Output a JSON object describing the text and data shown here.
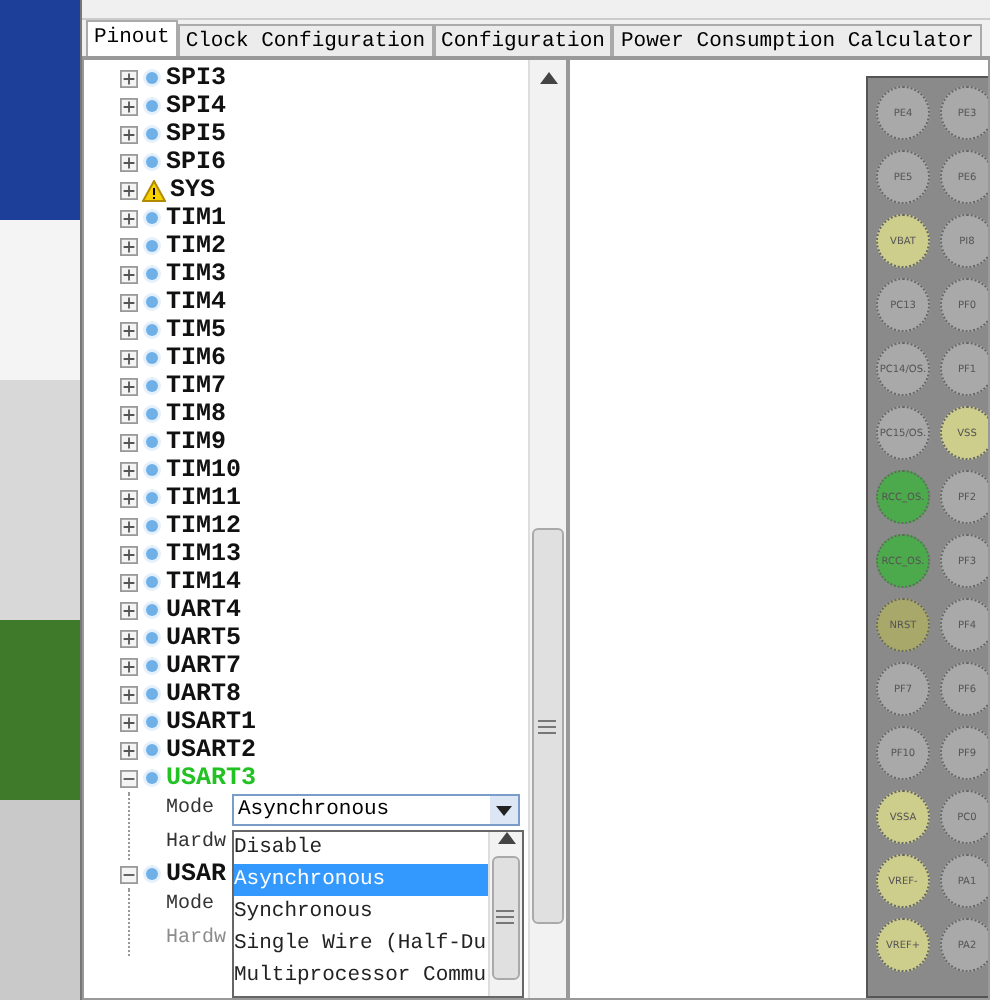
{
  "tabs": [
    {
      "label": "Pinout",
      "selected": true
    },
    {
      "label": "Clock Configuration",
      "selected": false
    },
    {
      "label": "Configuration",
      "selected": false
    },
    {
      "label": "Power Consumption Calculator",
      "selected": false
    }
  ],
  "tree": {
    "items": [
      {
        "label": "SPI3",
        "kind": "ok",
        "expanded": false,
        "configured": false
      },
      {
        "label": "SPI4",
        "kind": "ok",
        "expanded": false,
        "configured": false
      },
      {
        "label": "SPI5",
        "kind": "ok",
        "expanded": false,
        "configured": false
      },
      {
        "label": "SPI6",
        "kind": "ok",
        "expanded": false,
        "configured": false
      },
      {
        "label": "SYS",
        "kind": "warning",
        "expanded": false,
        "configured": false
      },
      {
        "label": "TIM1",
        "kind": "ok",
        "expanded": false,
        "configured": false
      },
      {
        "label": "TIM2",
        "kind": "ok",
        "expanded": false,
        "configured": false
      },
      {
        "label": "TIM3",
        "kind": "ok",
        "expanded": false,
        "configured": false
      },
      {
        "label": "TIM4",
        "kind": "ok",
        "expanded": false,
        "configured": false
      },
      {
        "label": "TIM5",
        "kind": "ok",
        "expanded": false,
        "configured": false
      },
      {
        "label": "TIM6",
        "kind": "ok",
        "expanded": false,
        "configured": false
      },
      {
        "label": "TIM7",
        "kind": "ok",
        "expanded": false,
        "configured": false
      },
      {
        "label": "TIM8",
        "kind": "ok",
        "expanded": false,
        "configured": false
      },
      {
        "label": "TIM9",
        "kind": "ok",
        "expanded": false,
        "configured": false
      },
      {
        "label": "TIM10",
        "kind": "ok",
        "expanded": false,
        "configured": false
      },
      {
        "label": "TIM11",
        "kind": "ok",
        "expanded": false,
        "configured": false
      },
      {
        "label": "TIM12",
        "kind": "ok",
        "expanded": false,
        "configured": false
      },
      {
        "label": "TIM13",
        "kind": "ok",
        "expanded": false,
        "configured": false
      },
      {
        "label": "TIM14",
        "kind": "ok",
        "expanded": false,
        "configured": false
      },
      {
        "label": "UART4",
        "kind": "ok",
        "expanded": false,
        "configured": false
      },
      {
        "label": "UART5",
        "kind": "ok",
        "expanded": false,
        "configured": false
      },
      {
        "label": "UART7",
        "kind": "ok",
        "expanded": false,
        "configured": false
      },
      {
        "label": "UART8",
        "kind": "ok",
        "expanded": false,
        "configured": false
      },
      {
        "label": "USART1",
        "kind": "ok",
        "expanded": false,
        "configured": false
      },
      {
        "label": "USART2",
        "kind": "ok",
        "expanded": false,
        "configured": false
      },
      {
        "label": "USART3",
        "kind": "ok",
        "expanded": true,
        "configured": true,
        "children": [
          {
            "kind": "combo",
            "label": "Mode",
            "value": "Asynchronous",
            "open": true,
            "options": [
              {
                "label": "Disable",
                "selected": false
              },
              {
                "label": "Asynchronous",
                "selected": true
              },
              {
                "label": "Synchronous",
                "selected": false
              },
              {
                "label": "Single Wire (Half-Du",
                "selected": false
              },
              {
                "label": "Multiprocessor Commu",
                "selected": false
              }
            ]
          },
          {
            "kind": "label",
            "label": "Hardw",
            "disabled": false
          }
        ]
      },
      {
        "label": "USAR",
        "kind": "ok",
        "expanded": true,
        "configured": false,
        "children": [
          {
            "kind": "label",
            "label": "Mode",
            "disabled": false
          },
          {
            "kind": "label",
            "label": "Hardw",
            "disabled": true
          }
        ]
      }
    ]
  },
  "chip": {
    "pin_rows": [
      [
        {
          "label": "PE4",
          "color": "#a9a9a9"
        },
        {
          "label": "PE3",
          "color": "#a9a9a9"
        }
      ],
      [
        {
          "label": "PE5",
          "color": "#a9a9a9"
        },
        {
          "label": "PE6",
          "color": "#a9a9a9"
        }
      ],
      [
        {
          "label": "VBAT",
          "color": "#cdcd8c"
        },
        {
          "label": "PI8",
          "color": "#a9a9a9"
        }
      ],
      [
        {
          "label": "PC13",
          "color": "#a9a9a9"
        },
        {
          "label": "PF0",
          "color": "#a9a9a9"
        }
      ],
      [
        {
          "label": "PC14/OS.",
          "color": "#a9a9a9"
        },
        {
          "label": "PF1",
          "color": "#a9a9a9"
        }
      ],
      [
        {
          "label": "PC15/OS.",
          "color": "#a9a9a9"
        },
        {
          "label": "VSS",
          "color": "#cdcd8c"
        }
      ],
      [
        {
          "label": "RCC_OS.",
          "color": "#4caa4c"
        },
        {
          "label": "PF2",
          "color": "#a9a9a9"
        }
      ],
      [
        {
          "label": "RCC_OS.",
          "color": "#4caa4c"
        },
        {
          "label": "PF3",
          "color": "#a9a9a9"
        }
      ],
      [
        {
          "label": "NRST",
          "color": "#a8a86a"
        },
        {
          "label": "PF4",
          "color": "#a9a9a9"
        }
      ],
      [
        {
          "label": "PF7",
          "color": "#a9a9a9"
        },
        {
          "label": "PF6",
          "color": "#a9a9a9"
        }
      ],
      [
        {
          "label": "PF10",
          "color": "#a9a9a9"
        },
        {
          "label": "PF9",
          "color": "#a9a9a9"
        }
      ],
      [
        {
          "label": "VSSA",
          "color": "#cdcd8c"
        },
        {
          "label": "PC0",
          "color": "#a9a9a9"
        }
      ],
      [
        {
          "label": "VREF-",
          "color": "#cdcd8c"
        },
        {
          "label": "PA1",
          "color": "#a9a9a9"
        }
      ],
      [
        {
          "label": "VREF+",
          "color": "#cdcd8c"
        },
        {
          "label": "PA2",
          "color": "#a9a9a9"
        }
      ]
    ]
  }
}
